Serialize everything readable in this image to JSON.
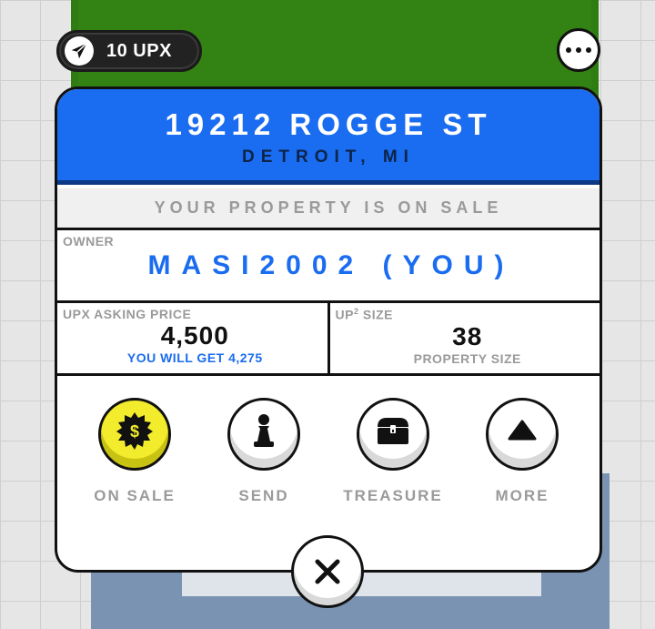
{
  "wallet": {
    "balance_label": "10 UPX",
    "icon": "paper-plane-icon"
  },
  "menu": {
    "icon": "more-dots-icon"
  },
  "property": {
    "address": "19212 ROGGE ST",
    "city": "DETROIT, MI",
    "status": "YOUR PROPERTY IS ON SALE",
    "owner_label": "OWNER",
    "owner_name": "MASI2002 (YOU)",
    "asking_price_label": "UPX ASKING PRICE",
    "asking_price_value": "4,500",
    "you_will_get": "YOU WILL GET 4,275",
    "size_label_prefix": "UP",
    "size_label_sup": "2",
    "size_label_suffix": " SIZE",
    "size_value": "38",
    "size_sub": "PROPERTY SIZE"
  },
  "actions": [
    {
      "label": "ON SALE",
      "icon": "dollar-badge-icon"
    },
    {
      "label": "SEND",
      "icon": "pawn-icon"
    },
    {
      "label": "TREASURE",
      "icon": "treasure-chest-icon"
    },
    {
      "label": "MORE",
      "icon": "triangle-up-icon"
    }
  ],
  "close": {
    "icon": "close-icon"
  },
  "colors": {
    "header_blue": "#1a6cf0",
    "header_dark": "#0c3a86",
    "on_sale_yellow": "#f2ec2c",
    "parcel_green": "#2f7d12",
    "parcel_blue": "#7a93b2",
    "muted_text": "#9a9a9a"
  }
}
